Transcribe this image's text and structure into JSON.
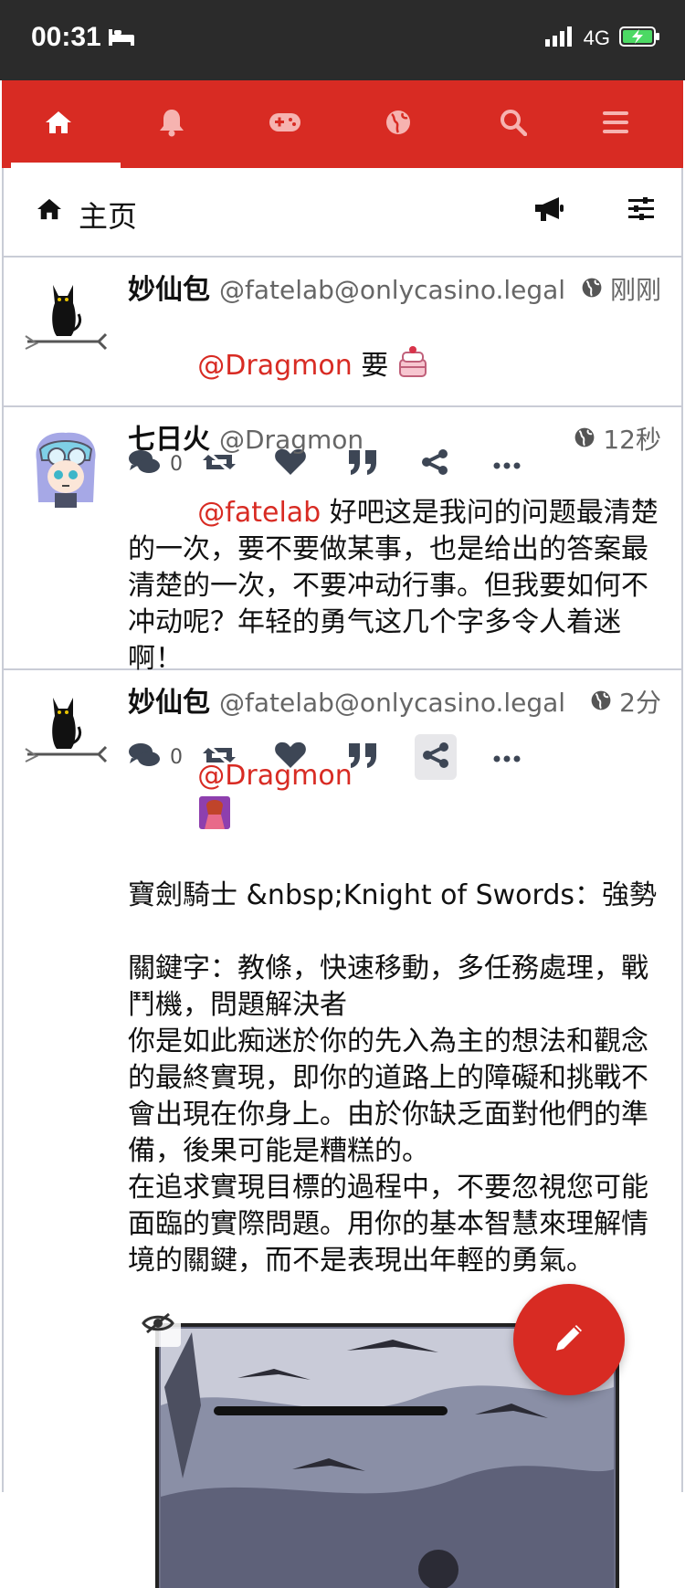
{
  "statusbar": {
    "time": "00:31",
    "network": "4G"
  },
  "nav": {
    "items": [
      "home-icon",
      "bell-icon",
      "gamepad-icon",
      "globe-icon",
      "search-icon",
      "menu-icon"
    ],
    "accent": "#d82b23"
  },
  "panel": {
    "title": "主页"
  },
  "posts": [
    {
      "name": "妙仙包",
      "acct": "@fatelab@onlycasino.legal",
      "time": "刚刚",
      "mention": "@Dragmon",
      "text": " 要 ",
      "replies": "0"
    },
    {
      "name": "七日火",
      "acct": "@Dragmon",
      "time": "12秒",
      "mention": "@fatelab",
      "text": " 好吧这是我问的问题最清楚的一次，要不要做某事，也是给出的答案最清楚的一次，不要冲动行事。但我要如何不冲动呢？年轻的勇气这几个字多令人着迷啊！",
      "replies": "0"
    },
    {
      "name": "妙仙包",
      "acct": "@fatelab@onlycasino.legal",
      "time": "2分",
      "mention": "@Dragmon",
      "text": "寶劍騎士 &nbsp;Knight of Swords：強勢\n\n關鍵字：教條，快速移動，多任務處理，戰鬥機，問題解決者\n你是如此痴迷於你的先入為主的想法和觀念的最終實現，即你的道路上的障礙和挑戰不會出現在你身上。由於你缺乏面對他們的準備，後果可能是糟糕的。\n在追求實現目標的過程中，不要忽視您可能面臨的實際問題。用你的基本智慧來理解情境的關鍵，而不是表現出年輕的勇氣。"
    }
  ]
}
